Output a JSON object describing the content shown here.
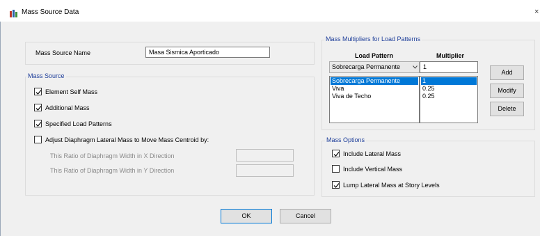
{
  "window": {
    "title": "Mass Source Data",
    "close_glyph": "×"
  },
  "mass_source_name": {
    "label": "Mass Source Name",
    "value": "Masa Sismica Aporticado"
  },
  "mass_source": {
    "title": "Mass Source",
    "options": [
      {
        "label": "Element Self Mass",
        "checked": true
      },
      {
        "label": "Additional Mass",
        "checked": true
      },
      {
        "label": "Specified Load Patterns",
        "checked": true
      },
      {
        "label": "Adjust Diaphragm Lateral Mass to Move Mass Centroid by:",
        "checked": false
      }
    ],
    "ratio_x_label": "This Ratio of Diaphragm Width in X Direction",
    "ratio_y_label": "This Ratio of Diaphragm Width in Y Direction",
    "ratio_x_value": "",
    "ratio_y_value": ""
  },
  "multipliers": {
    "title": "Mass Multipliers for Load Patterns",
    "col_pattern": "Load Pattern",
    "col_multiplier": "Multiplier",
    "selected_pattern": "Sobrecarga Permanente",
    "multiplier_value": "1",
    "rows": [
      {
        "pattern": "Sobrecarga Permanente",
        "multiplier": "1",
        "selected": true
      },
      {
        "pattern": "Viva",
        "multiplier": "0.25",
        "selected": false
      },
      {
        "pattern": "Viva de Techo",
        "multiplier": "0.25",
        "selected": false
      }
    ],
    "add_label": "Add",
    "modify_label": "Modify",
    "delete_label": "Delete"
  },
  "mass_options": {
    "title": "Mass Options",
    "options": [
      {
        "label": "Include Lateral Mass",
        "checked": true
      },
      {
        "label": "Include Vertical Mass",
        "checked": false
      },
      {
        "label": "Lump Lateral Mass at Story Levels",
        "checked": true
      }
    ]
  },
  "footer": {
    "ok_label": "OK",
    "cancel_label": "Cancel"
  },
  "icons": {
    "app": "app-grid-icon",
    "check": "checkmark-icon",
    "dropdown": "chevron-down-icon",
    "close": "close-icon"
  }
}
